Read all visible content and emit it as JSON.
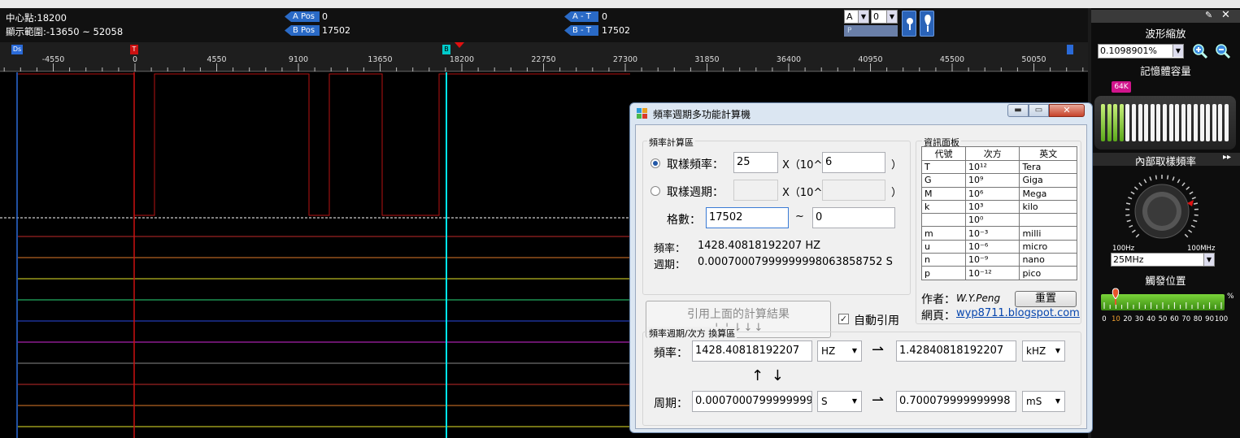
{
  "header": {
    "center_label": "中心點:18200",
    "range_label": "顯示範圍:-13650 ~ 52058",
    "a_pos_label": "A Pos",
    "a_pos_value": "0",
    "b_pos_label": "B Pos",
    "b_pos_value": "17502",
    "a_t_label": "A - T",
    "a_t_value": "0",
    "b_t_label": "B - T",
    "b_t_value": "17502",
    "select_a": "A",
    "select_num": "0",
    "p_label": "P"
  },
  "ruler": {
    "ticks": [
      "-4550",
      "0",
      "4550",
      "9100",
      "13650",
      "18200",
      "22750",
      "27300",
      "31850",
      "36400",
      "40950",
      "45500",
      "50050"
    ],
    "marker_ds": "Ds",
    "marker_t": "T",
    "marker_b": "B"
  },
  "right_panel": {
    "zoom_title": "波形縮放",
    "zoom_value": "0.1098901%",
    "memory_title": "記憶體容量",
    "memory_badge": "64K",
    "memory_level": 0.2,
    "sample_title": "內部取樣頻率",
    "sample_min": "100Hz",
    "sample_max": "100MHz",
    "sample_value": "25MHz",
    "trigger_title": "觸發位置",
    "trigger_scale": [
      "0",
      "10",
      "20",
      "30",
      "40",
      "50",
      "60",
      "70",
      "80",
      "90",
      "100"
    ],
    "trigger_unit": "%",
    "trigger_value": 10
  },
  "dialog": {
    "title": "頻率週期多功能計算機",
    "calc_group": "頻率計算區",
    "sample_freq_label": "取樣頻率：",
    "sample_freq_value": "25",
    "x_label1": "X（10^",
    "exp1_value": "6",
    "close_paren1": "）",
    "sample_period_label": "取樣週期：",
    "x_label2": "X（10^",
    "close_paren2": "）",
    "grid_label": "格數：",
    "grid_value": "17502",
    "tilde": "~",
    "grid_value2": "0",
    "freq_result_label": "頻率：",
    "freq_result": "1428.40818192207 HZ",
    "period_result_label": "週期：",
    "period_result": "0.00070007999999998063858752 S",
    "cite_button_line1": "引用上面的計算結果",
    "cite_button_line2": "↓↓↓↓↓",
    "auto_cite_label": "自動引用",
    "info_group": "資訊面板",
    "prefix_table": {
      "headers": [
        "代號",
        "次方",
        "英文"
      ],
      "rows": [
        [
          "T",
          "10¹²",
          "Tera"
        ],
        [
          "G",
          "10⁹",
          "Giga"
        ],
        [
          "M",
          "10⁶",
          "Mega"
        ],
        [
          "k",
          "10³",
          "kilo"
        ],
        [
          "",
          "10⁰",
          ""
        ],
        [
          "m",
          "10⁻³",
          "milli"
        ],
        [
          "u",
          "10⁻⁶",
          "micro"
        ],
        [
          "n",
          "10⁻⁹",
          "nano"
        ],
        [
          "p",
          "10⁻¹²",
          "pico"
        ]
      ]
    },
    "author_label": "作者：",
    "author_name": "W.Y.Peng",
    "reset_button": "重置",
    "web_label": "網頁：",
    "web_link": "wyp8711.blogspot.com",
    "convert_group": "頻率週期/次方 換算區",
    "conv_freq_label": "頻率：",
    "conv_freq_value": "1428.40818192207",
    "conv_freq_unit": "HZ",
    "arrow_right": "⇀",
    "conv_freq_result": "1.42840818192207",
    "conv_freq_result_unit": "kHZ",
    "updown": "↑ ↓",
    "conv_period_label": "周期：",
    "conv_period_value": "0.0007000799999999",
    "conv_period_unit": "S",
    "conv_period_result": "0.700079999999998",
    "conv_period_result_unit": "mS"
  },
  "colors": {
    "bg": "#000000",
    "cursor_red": "#cc1111",
    "cursor_cyan": "#00e5ee",
    "ds_line": "#2a6ad8"
  }
}
